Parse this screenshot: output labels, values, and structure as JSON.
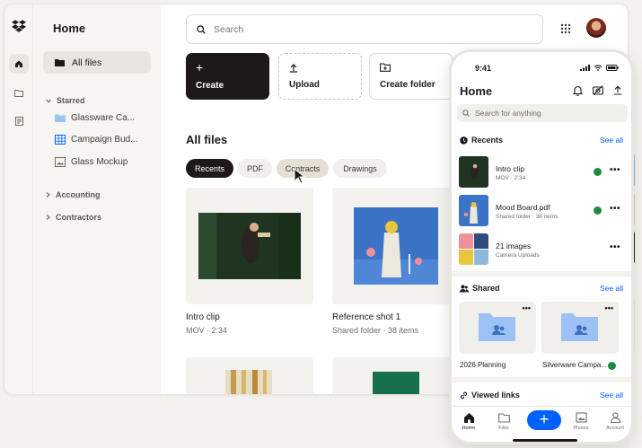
{
  "desktop": {
    "sidebar": {
      "title": "Home",
      "all_files": "All files",
      "starred_label": "Starred",
      "starred_items": [
        "Glassware Ca...",
        "Campaign Bud...",
        "Glass Mockup"
      ],
      "accounting_label": "Accounting",
      "contractors_label": "Contractors"
    },
    "search": {
      "placeholder": "Search"
    },
    "actions": {
      "create": "Create",
      "upload": "Upload",
      "create_folder": "Create folder"
    },
    "all_files_title": "All files",
    "filters": [
      "Recents",
      "PDF",
      "Contracts",
      "Drawings"
    ],
    "files": [
      {
        "name": "Intro clip",
        "meta": "MOV · 2:34"
      },
      {
        "name": "Reference shot 1",
        "meta": "Shared folder · 38 items"
      }
    ]
  },
  "phone": {
    "time": "9:41",
    "title": "Home",
    "search_placeholder": "Search for anything",
    "recents_label": "Recents",
    "see_all": "See all",
    "recents": [
      {
        "name": "Intro clip",
        "meta": "MOV · 2:34"
      },
      {
        "name": "Mood Board.pdf",
        "meta": "Shared folder · 38 items"
      },
      {
        "name": "21 images",
        "meta": "Camera Uploads"
      }
    ],
    "shared_label": "Shared",
    "shared": [
      "2026 Planning",
      "Silverware Campa..."
    ],
    "viewed_links_label": "Viewed links",
    "tabs": [
      "Home",
      "Files",
      "Photos",
      "Account"
    ]
  }
}
